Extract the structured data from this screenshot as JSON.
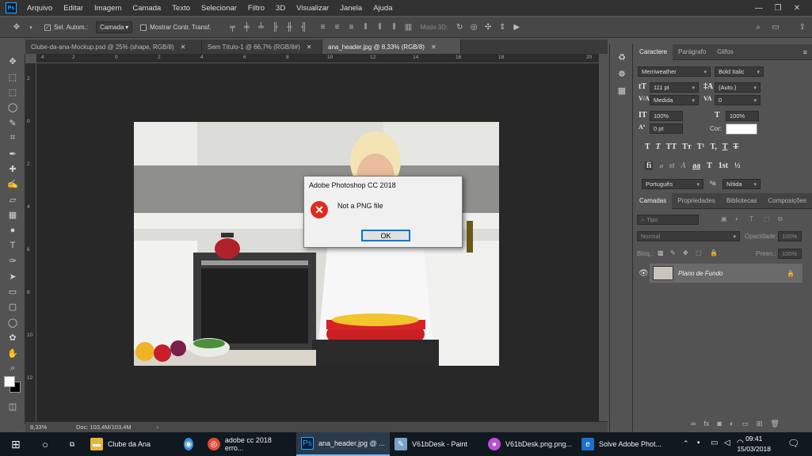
{
  "menubar": {
    "logo": "Ps",
    "items": [
      "Arquivo",
      "Editar",
      "Imagem",
      "Camada",
      "Texto",
      "Selecionar",
      "Filtro",
      "3D",
      "Visualizar",
      "Janela",
      "Ajuda"
    ]
  },
  "options": {
    "auto_select_label": "Sel. Autom.:",
    "auto_select_value": "Camada",
    "show_transform_label": "Mostrar Contr. Transf.",
    "mode_3d_label": "Modo 3D:"
  },
  "tabs": [
    {
      "label": "Clube-da-ana-Mockup.psd @ 25% (shape, RGB/8)"
    },
    {
      "label": "Sem Título-1 @ 66,7% (RGB/8#)"
    },
    {
      "label": "ana_header.jpg @ 8,33% (RGB/8)"
    }
  ],
  "ruler": {
    "h_ticks": [
      "4",
      "2",
      "0",
      "2",
      "4",
      "6",
      "8",
      "10",
      "12",
      "14",
      "16",
      "18",
      "20"
    ],
    "v_ticks": [
      "2",
      "0",
      "2",
      "4",
      "6",
      "8",
      "10",
      "12"
    ]
  },
  "status": {
    "zoom": "8,33%",
    "doc": "Doc: 103,4M/103,4M"
  },
  "dialog": {
    "title": "Adobe Photoshop CC 2018",
    "message": "Not a PNG file",
    "ok_label": "OK"
  },
  "character_panel": {
    "tabs": [
      "Caractere",
      "Parágrafo",
      "Glifos"
    ],
    "font_family": "Merriweather",
    "font_style": "Bold Italic",
    "font_size": "111 pt",
    "leading": "(Auto.)",
    "kerning": "Medida",
    "tracking": "0",
    "vertical_scale": "100%",
    "horizontal_scale": "100%",
    "baseline_shift": "0 pt",
    "color_label": "Cor:",
    "type_buttons": [
      "T",
      "T",
      "TT",
      "Tт",
      "T¹",
      "T,",
      "T",
      "T"
    ],
    "opentype_buttons": [
      "fi",
      "ℴ",
      "st",
      "A",
      "aa",
      "T",
      "1st",
      "½"
    ],
    "language": "Português",
    "antialias_prefix": "ªa",
    "antialias": "Nítida",
    "color_value": "#ffffff"
  },
  "layers_panel": {
    "tabs": [
      "Camadas",
      "Propriedades",
      "Bibliotecas",
      "Composições"
    ],
    "filter_placeholder": "Tipo",
    "blend_mode": "Normal",
    "opacity_label": "Opacidade:",
    "opacity_value": "100%",
    "lock_label": "Bloq.:",
    "fill_label": "Preen.:",
    "fill_value": "100%",
    "layer_name": "Plano de Fundo"
  },
  "taskbar": {
    "items": [
      {
        "label": "Clube da Ana"
      },
      {
        "label": "adobe cc 2018 erro..."
      },
      {
        "label": "ana_header.jpg @ ..."
      },
      {
        "label": "V61bDesk - Paint"
      },
      {
        "label": "V61bDesk.png.png..."
      },
      {
        "label": "Solve Adobe Phot..."
      }
    ],
    "time": "09:41",
    "date": "15/03/2018"
  }
}
